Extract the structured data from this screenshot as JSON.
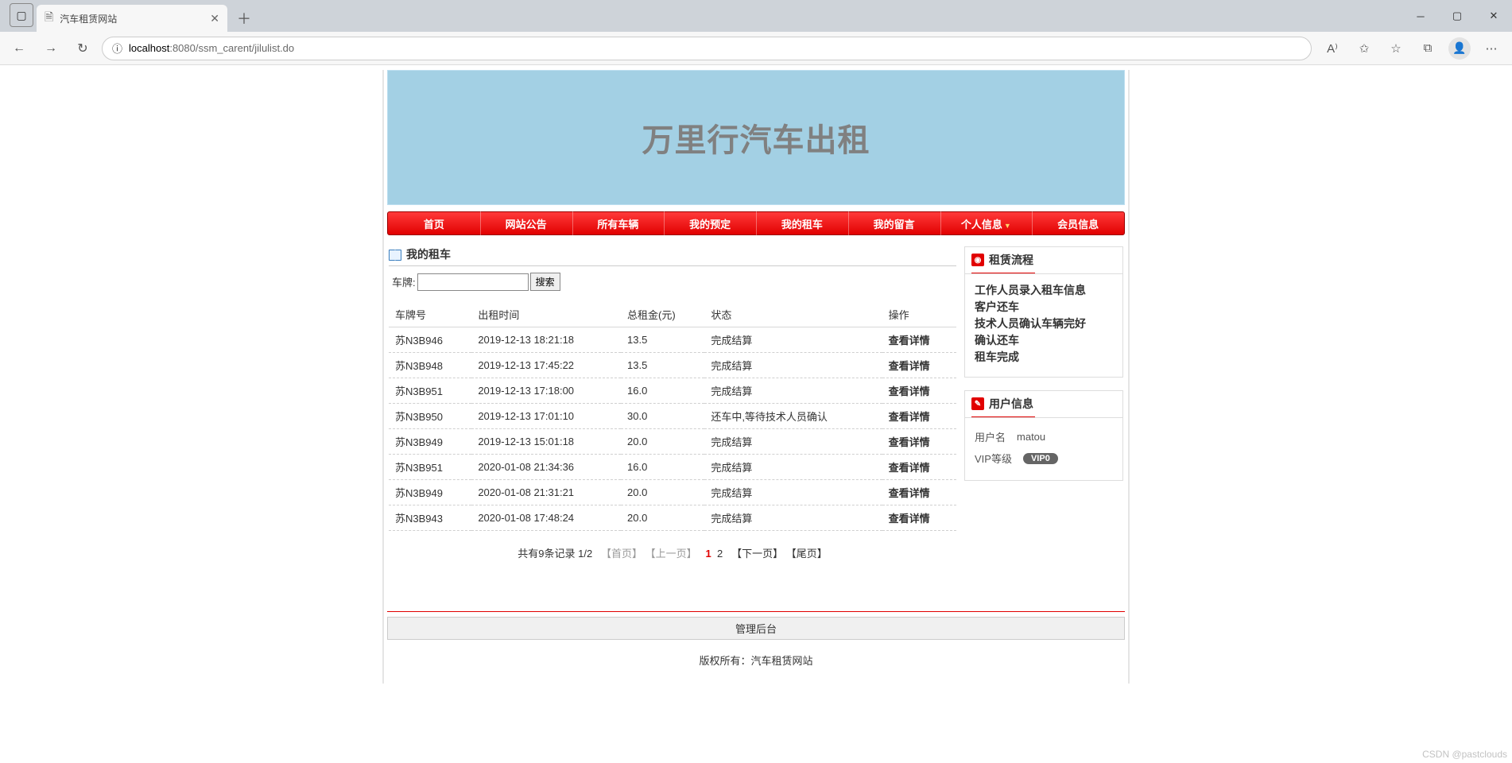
{
  "browser": {
    "tab_title": "汽车租赁网站",
    "url_host": "localhost",
    "url_port_path": ":8080/ssm_carent/jilulist.do"
  },
  "banner": {
    "title": "万里行汽车出租"
  },
  "nav": {
    "items": [
      {
        "label": "首页"
      },
      {
        "label": "网站公告"
      },
      {
        "label": "所有车辆"
      },
      {
        "label": "我的预定"
      },
      {
        "label": "我的租车"
      },
      {
        "label": "我的留言"
      },
      {
        "label": "个人信息",
        "caret": true
      },
      {
        "label": "会员信息"
      }
    ]
  },
  "main": {
    "panel_title": "我的租车",
    "search_label": "车牌:",
    "search_value": "",
    "search_button": "搜索",
    "columns": [
      "车牌号",
      "出租时间",
      "总租金(元)",
      "状态",
      "操作"
    ],
    "action_label": "查看详情",
    "rows": [
      {
        "plate": "苏N3B946",
        "time": "2019-12-13 18:21:18",
        "rent": "13.5",
        "status": "完成结算"
      },
      {
        "plate": "苏N3B948",
        "time": "2019-12-13 17:45:22",
        "rent": "13.5",
        "status": "完成结算"
      },
      {
        "plate": "苏N3B951",
        "time": "2019-12-13 17:18:00",
        "rent": "16.0",
        "status": "完成结算"
      },
      {
        "plate": "苏N3B950",
        "time": "2019-12-13 17:01:10",
        "rent": "30.0",
        "status": "还车中,等待技术人员确认"
      },
      {
        "plate": "苏N3B949",
        "time": "2019-12-13 15:01:18",
        "rent": "20.0",
        "status": "完成结算"
      },
      {
        "plate": "苏N3B951",
        "time": "2020-01-08 21:34:36",
        "rent": "16.0",
        "status": "完成结算"
      },
      {
        "plate": "苏N3B949",
        "time": "2020-01-08 21:31:21",
        "rent": "20.0",
        "status": "完成结算"
      },
      {
        "plate": "苏N3B943",
        "time": "2020-01-08 17:48:24",
        "rent": "20.0",
        "status": "完成结算"
      }
    ],
    "pager": {
      "summary": "共有9条记录   1/2",
      "first": "【首页】",
      "prev": "【上一页】",
      "p1": "1",
      "p2": "2",
      "next": "【下一页】",
      "last": "【尾页】"
    }
  },
  "sidebar": {
    "process": {
      "title": "租赁流程",
      "steps": [
        "工作人员录入租车信息",
        "客户还车",
        "技术人员确认车辆完好",
        "确认还车",
        "租车完成"
      ]
    },
    "user": {
      "title": "用户信息",
      "name_label": "用户名",
      "name_value": "matou",
      "vip_label": "VIP等级",
      "vip_value": "VIP0"
    }
  },
  "footer": {
    "admin_link": "管理后台",
    "copyright": "版权所有：汽车租赁网站"
  },
  "watermark": "CSDN @pastclouds"
}
